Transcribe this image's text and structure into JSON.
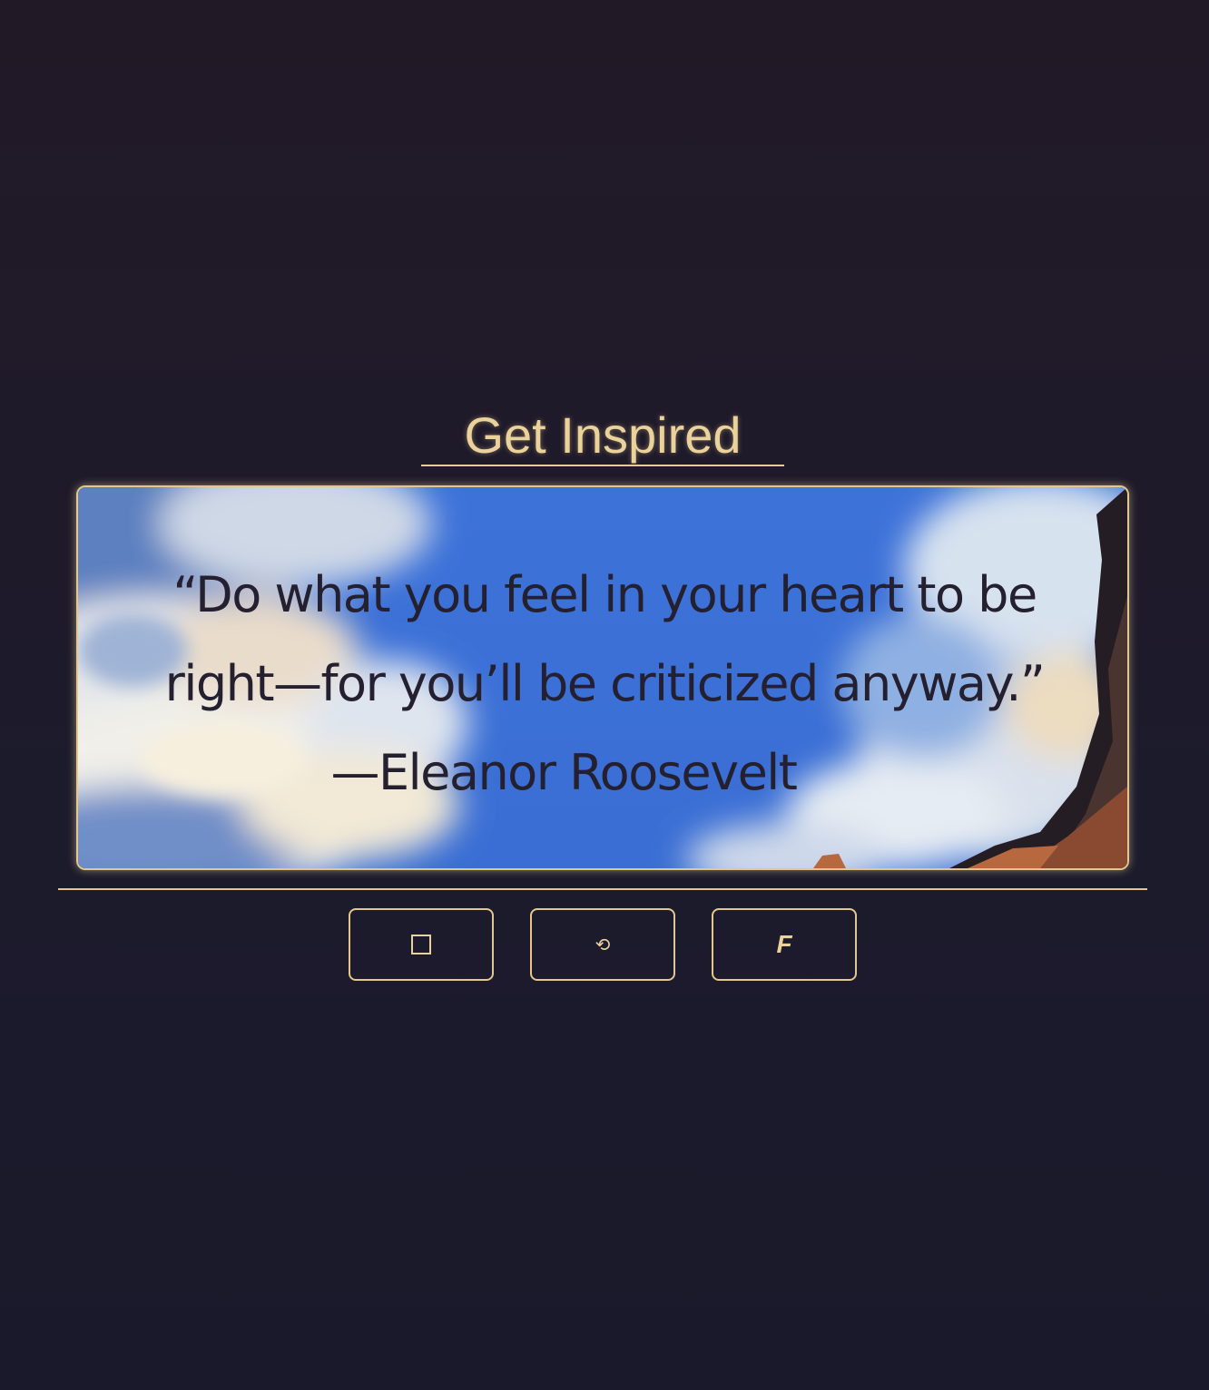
{
  "page": {
    "title": "Get Inspired"
  },
  "quote": {
    "text": "“Do what you feel in your heart to be right—for you’ll be criticized anyway.”",
    "author": "—Eleanor Roosevelt"
  },
  "buttons": [
    {
      "icon": "square-icon"
    },
    {
      "icon": "refresh-icon",
      "glyph": "⟲"
    },
    {
      "icon": "f-icon",
      "glyph": "F"
    }
  ],
  "colors": {
    "accent": "#e3c88d",
    "title": "#ebd19a",
    "background": "#1c1a2b",
    "quote_text": "#24202f",
    "sky_blue": "#3a70d8"
  }
}
